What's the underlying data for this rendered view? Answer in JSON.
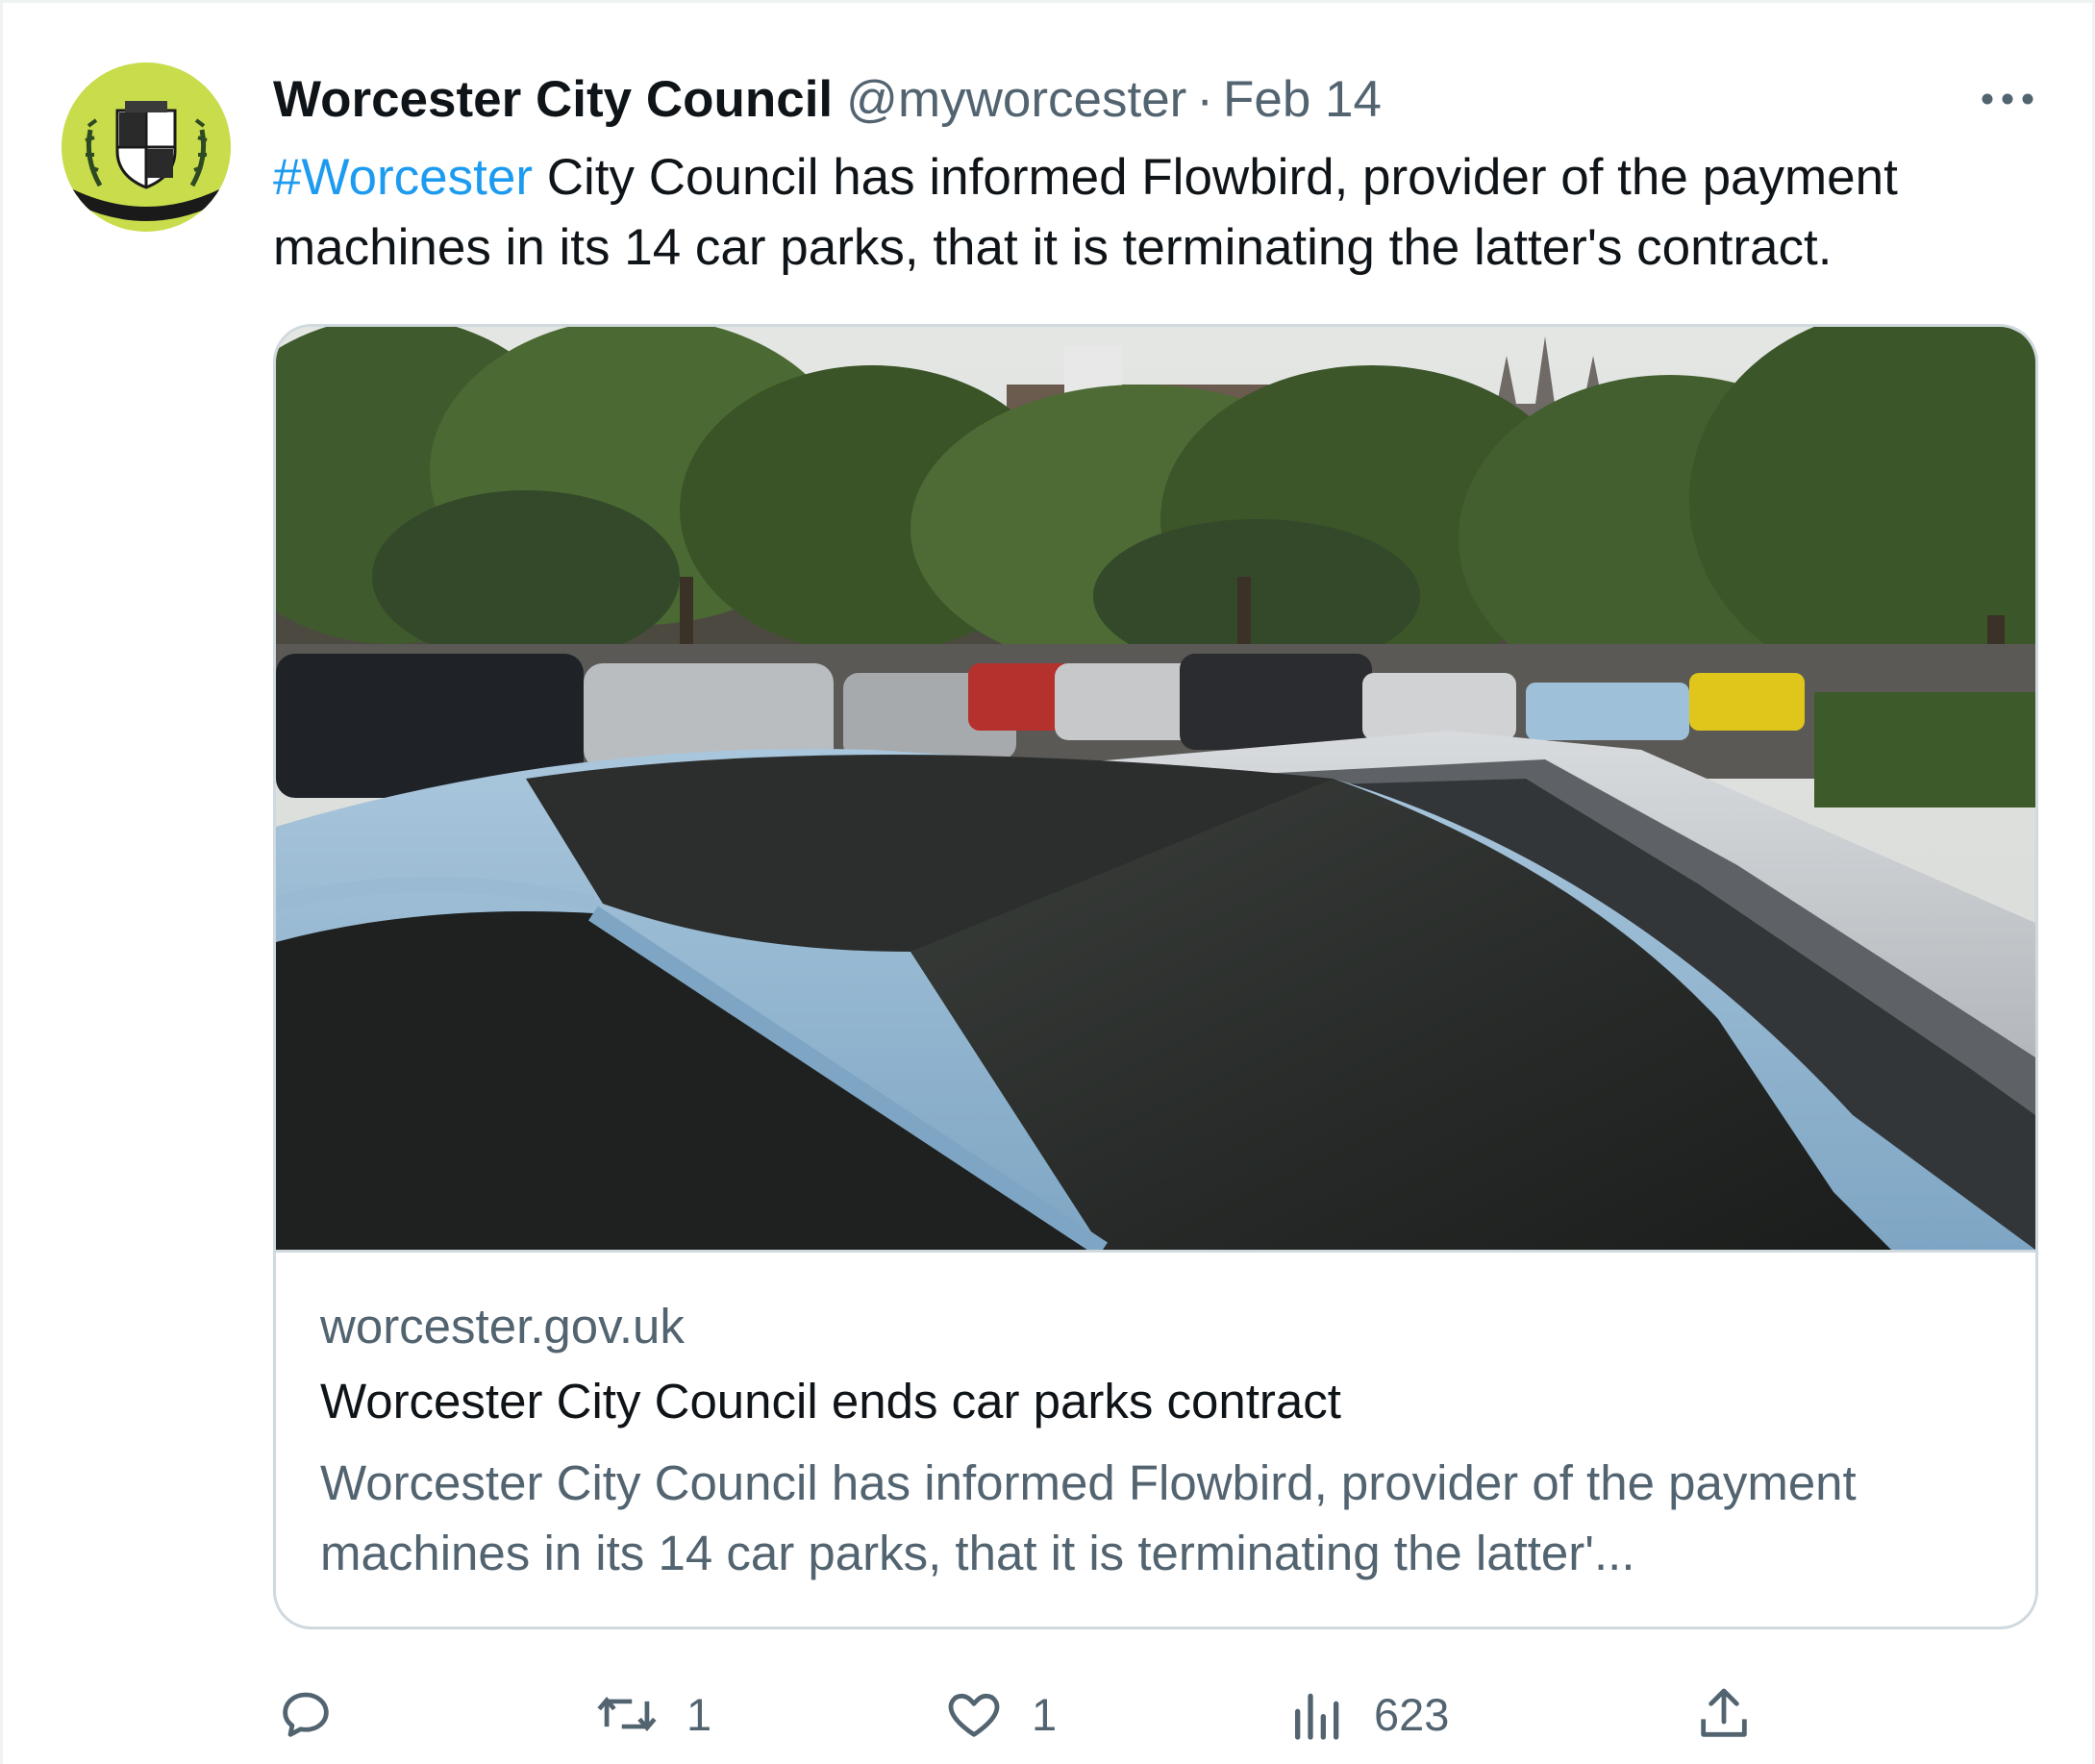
{
  "tweet": {
    "display_name": "Worcester City Council",
    "handle": "@myworcester",
    "separator": "·",
    "timestamp": "Feb 14",
    "text": {
      "hashtag": "#Worcester",
      "body": " City Council has informed Flowbird, provider of the payment machines in its 14 car parks, that it is terminating the latter's contract."
    },
    "avatar_icon": "worcester-crest-icon",
    "more_icon": "more-dots-icon"
  },
  "card": {
    "domain": "worcester.gov.uk",
    "title": "Worcester City Council ends car parks contract",
    "description": "Worcester City Council has informed Flowbird, provider of the payment machines in its 14 car parks, that it is terminating the latter'..."
  },
  "actions": {
    "reply": {
      "icon": "reply-icon",
      "count": ""
    },
    "retweet": {
      "icon": "retweet-icon",
      "count": "1"
    },
    "like": {
      "icon": "heart-icon",
      "count": "1"
    },
    "views": {
      "icon": "views-chart-icon",
      "count": "623"
    },
    "share": {
      "icon": "share-icon"
    }
  },
  "colors": {
    "hashtag": "#1d9bf0",
    "secondary_text": "#536471",
    "primary_text": "#0f1419",
    "card_border": "#cfd9de",
    "avatar_bg": "#c8dc4c"
  }
}
